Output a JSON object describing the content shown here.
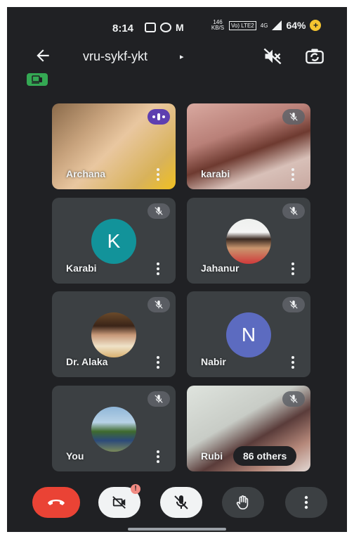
{
  "status_bar": {
    "time": "8:14",
    "icons_left": [
      "screen-record-icon",
      "whatsapp-icon",
      "gmail-icon"
    ],
    "net_speed": "146 KB/S",
    "volte": "Vo) LTE2",
    "network": "4G",
    "battery": "64%"
  },
  "header": {
    "meeting_code": "vru-sykf-ykt",
    "caret": "▸"
  },
  "participants": [
    {
      "name": "Archana",
      "type": "video",
      "status": "speaking"
    },
    {
      "name": "karabi",
      "type": "video",
      "status": "muted"
    },
    {
      "name": "Karabi",
      "type": "initial",
      "initial": "K",
      "avatar_color": "#12939a",
      "status": "muted"
    },
    {
      "name": "Jahanur",
      "type": "photo",
      "status": "muted"
    },
    {
      "name": "Dr. Alaka",
      "type": "photo",
      "status": "muted"
    },
    {
      "name": "Nabir",
      "type": "initial",
      "initial": "N",
      "avatar_color": "#5c6bc0",
      "status": "muted"
    },
    {
      "name": "You",
      "type": "photo",
      "status": "muted"
    },
    {
      "name": "Rubi",
      "type": "video",
      "status": "muted"
    }
  ],
  "others_count_label": "86 others",
  "controls": {
    "end_call": "end-call-icon",
    "camera": "camera-off-icon",
    "mic": "mic-off-icon",
    "hand": "raise-hand-icon",
    "more": "more-vert-icon",
    "camera_alert": "!"
  },
  "colors": {
    "background": "#202124",
    "tile": "#3c4043",
    "end_call": "#ea4335",
    "speaking": "#5e3fb0",
    "badge_green": "#34a853"
  }
}
